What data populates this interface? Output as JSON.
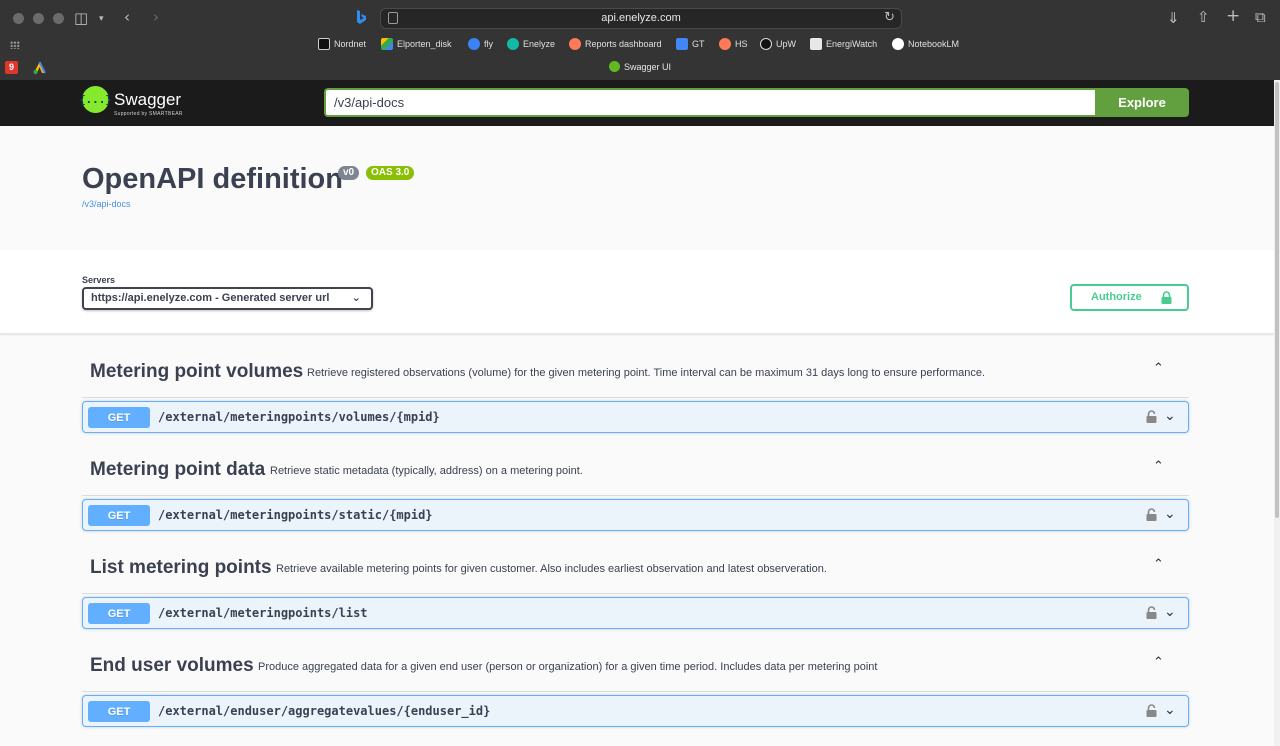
{
  "browser": {
    "url": "api.enelyze.com",
    "active_tab_title": "Swagger UI",
    "pinned_tabs": [
      {
        "icon": "nine-tab-icon",
        "label": "9",
        "color": "#e0362c"
      },
      {
        "icon": "ads-tab-icon",
        "label": "",
        "color": "#fbbc04"
      }
    ],
    "bookmarks": [
      {
        "label": "Nordnet",
        "icon": "nordnet-icon",
        "color": "#111111"
      },
      {
        "label": "Elporten_disk",
        "icon": "drive-icon",
        "color": "#fbbc04"
      },
      {
        "label": "fly",
        "icon": "fly-icon",
        "color": "#3b82f6"
      },
      {
        "label": "Enelyze",
        "icon": "enelyze-icon",
        "color": "#14b8a6"
      },
      {
        "label": "Reports dashboard",
        "icon": "hubspot-icon",
        "color": "#ff7a59"
      },
      {
        "label": "GT",
        "icon": "translate-icon",
        "color": "#4285f4"
      },
      {
        "label": "HS",
        "icon": "hubspot-icon",
        "color": "#ff7a59"
      },
      {
        "label": "UpW",
        "icon": "upwork-icon",
        "color": "#111111"
      },
      {
        "label": "EnergiWatch",
        "icon": "energiwatch-icon",
        "color": "#e8e8e8"
      },
      {
        "label": "NotebookLM",
        "icon": "notebooklm-icon",
        "color": "#ffffff"
      }
    ]
  },
  "topbar": {
    "logo_text": "Swagger",
    "logo_sub": "Supported by SMARTBEAR",
    "logo_mark": "{...}",
    "spec_url": "/v3/api-docs",
    "explore_label": "Explore"
  },
  "info": {
    "title": "OpenAPI definition",
    "version_badge": "v0",
    "oas_badge": "OAS 3.0",
    "link": "/v3/api-docs"
  },
  "servers": {
    "label": "Servers",
    "selected": "https://api.enelyze.com - Generated server url"
  },
  "authorize_label": "Authorize",
  "tags": [
    {
      "name": "Metering point volumes",
      "description": "Retrieve registered observations (volume) for the given metering point. Time interval can be maximum 31 days long to ensure performance.",
      "operations": [
        {
          "method": "GET",
          "path": "/external/meteringpoints/volumes/{mpid}"
        }
      ]
    },
    {
      "name": "Metering point data",
      "description": "Retrieve static metadata (typically, address) on a metering point.",
      "operations": [
        {
          "method": "GET",
          "path": "/external/meteringpoints/static/{mpid}"
        }
      ]
    },
    {
      "name": "List metering points",
      "description": "Retrieve available metering points for given customer. Also includes earliest observation and latest observeration.",
      "operations": [
        {
          "method": "GET",
          "path": "/external/meteringpoints/list"
        }
      ]
    },
    {
      "name": "End user volumes",
      "description": "Produce aggregated data for a given end user (person or organization) for a given time period. Includes data per metering point",
      "operations": [
        {
          "method": "GET",
          "path": "/external/enduser/aggregatevalues/{enduser_id}"
        }
      ]
    }
  ],
  "colors": {
    "get_method": "#61affe",
    "get_bg": "#ebf3fb",
    "topbar": "#1b1b1b",
    "explore": "#62a03f",
    "authorize": "#49cc90",
    "oas_badge": "#89bf04",
    "version_badge": "#7d8492"
  }
}
